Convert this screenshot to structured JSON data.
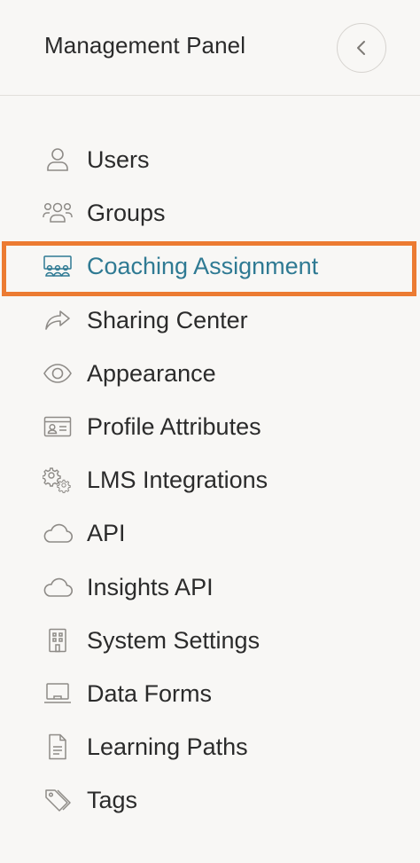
{
  "header": {
    "title": "Management Panel",
    "collapse_icon": "chevron-left-icon"
  },
  "nav": {
    "active_index": 2,
    "items": [
      {
        "label": "Users",
        "icon": "user-icon"
      },
      {
        "label": "Groups",
        "icon": "groups-icon"
      },
      {
        "label": "Coaching Assignment",
        "icon": "coaching-icon"
      },
      {
        "label": "Sharing Center",
        "icon": "share-arrow-icon"
      },
      {
        "label": "Appearance",
        "icon": "eye-icon"
      },
      {
        "label": "Profile Attributes",
        "icon": "id-card-icon"
      },
      {
        "label": "LMS Integrations",
        "icon": "gears-icon"
      },
      {
        "label": "API",
        "icon": "cloud-icon"
      },
      {
        "label": "Insights API",
        "icon": "cloud-icon"
      },
      {
        "label": "System Settings",
        "icon": "building-icon"
      },
      {
        "label": "Data Forms",
        "icon": "laptop-icon"
      },
      {
        "label": "Learning Paths",
        "icon": "document-icon"
      },
      {
        "label": "Tags",
        "icon": "tags-icon"
      }
    ]
  },
  "colors": {
    "background": "#f8f7f5",
    "text": "#2b2b2b",
    "active_text": "#2f7a93",
    "highlight_border": "#ec7b32",
    "icon_stroke": "#8e8b87"
  }
}
